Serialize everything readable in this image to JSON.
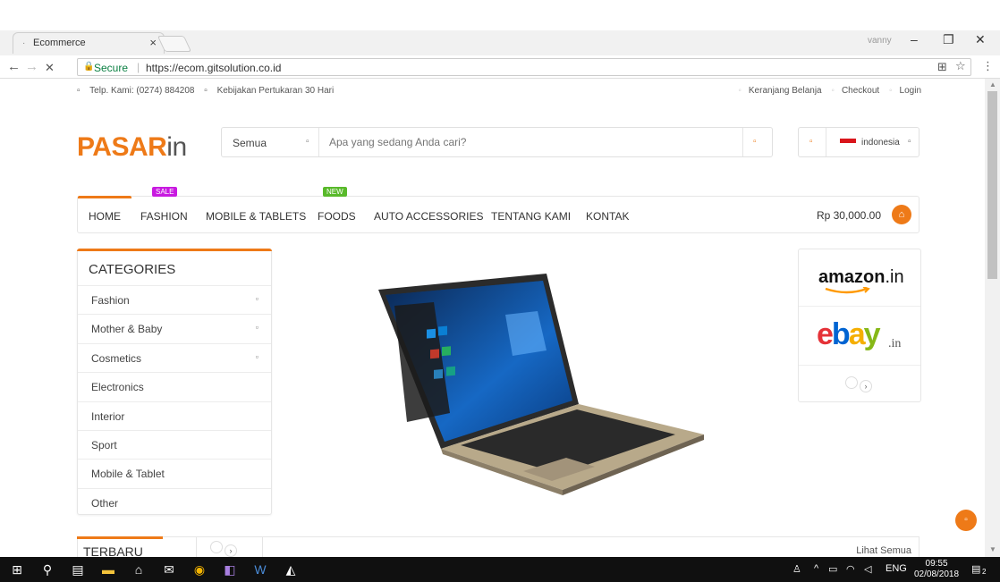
{
  "browser": {
    "tab_title": "Ecommerce",
    "tab_close": "×",
    "profile": "vanny",
    "secure_label": "Secure",
    "url": "https://ecom.gitsolution.co.id"
  },
  "topbar": {
    "phone": "Telp. Kami: (0274) 884208",
    "policy": "Kebijakan Pertukaran 30 Hari",
    "cart_link": "Keranjang Belanja",
    "checkout_link": "Checkout",
    "login_link": "Login"
  },
  "logo": {
    "main": "PASAR",
    "suffix": "in"
  },
  "search": {
    "category": "Semua",
    "placeholder": "Apa yang sedang Anda cari?"
  },
  "language": {
    "name": "indonesia"
  },
  "menu": {
    "items": [
      "HOME",
      "FASHION",
      "MOBILE & TABLETS",
      "FOODS",
      "AUTO ACCESSORIES",
      "TENTANG KAMI",
      "KONTAK"
    ],
    "sale_badge": "SALE",
    "new_badge": "NEW",
    "cart_total": "Rp 30,000.00"
  },
  "categories": {
    "title": "CATEGORIES",
    "items": [
      "Fashion",
      "Mother & Baby",
      "Cosmetics",
      "Electronics",
      "Interior",
      "Sport",
      "Mobile & Tablet",
      "Other"
    ]
  },
  "brands": {
    "amazon": "amazon",
    "amazon_tld": ".in",
    "ebay_tld": ".in"
  },
  "new_section": {
    "title": "TERBARU",
    "see_all": "Lihat Semua"
  },
  "taskbar": {
    "lang": "ENG",
    "time": "09:55",
    "date": "02/08/2018",
    "notif_count": "2"
  },
  "colors": {
    "accent": "#ee7a18",
    "sale": "#c81ae0",
    "new": "#58b92a"
  }
}
